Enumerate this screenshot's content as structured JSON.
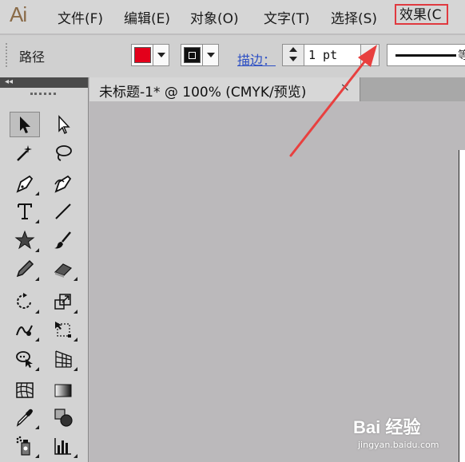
{
  "app": {
    "logo": "Ai"
  },
  "menu": [
    {
      "label": "文件(F)"
    },
    {
      "label": "编辑(E)"
    },
    {
      "label": "对象(O)"
    },
    {
      "label": "文字(T)"
    },
    {
      "label": "选择(S)"
    },
    {
      "label": "效果(C"
    }
  ],
  "control_bar": {
    "selection_label": "路径",
    "fill_color": "#e3001b",
    "stroke_link": "描边：",
    "stroke_weight": "1 pt",
    "profile_char": "等"
  },
  "toolbox": {
    "collapse_glyph": "◂◂",
    "tools": [
      {
        "name": "selection-tool-icon",
        "selected": true
      },
      {
        "name": "direct-selection-tool-icon"
      },
      {
        "name": "magic-wand-tool-icon"
      },
      {
        "name": "lasso-tool-icon"
      },
      {
        "name": "pen-tool-icon"
      },
      {
        "name": "curvature-pen-tool-icon"
      },
      {
        "name": "type-tool-icon"
      },
      {
        "name": "line-segment-tool-icon"
      },
      {
        "name": "star-tool-icon"
      },
      {
        "name": "paintbrush-tool-icon"
      },
      {
        "name": "pencil-tool-icon"
      },
      {
        "name": "eraser-tool-icon"
      },
      {
        "name": "rotate-tool-icon"
      },
      {
        "name": "scale-tool-icon"
      },
      {
        "name": "warp-tool-icon"
      },
      {
        "name": "free-transform-tool-icon"
      },
      {
        "name": "shape-builder-tool-icon"
      },
      {
        "name": "perspective-grid-tool-icon"
      },
      {
        "name": "mesh-tool-icon"
      },
      {
        "name": "gradient-tool-icon"
      },
      {
        "name": "eyedropper-tool-icon"
      },
      {
        "name": "blend-tool-icon"
      },
      {
        "name": "symbol-sprayer-tool-icon"
      },
      {
        "name": "column-graph-tool-icon"
      }
    ]
  },
  "document": {
    "tab_title": "未标题-1* @ 100% (CMYK/预览)",
    "close_glyph": "×"
  },
  "annotation": {
    "color": "#e8403f"
  },
  "watermark": {
    "logo": "Bai 经验",
    "url": "jingyan.baidu.com"
  }
}
